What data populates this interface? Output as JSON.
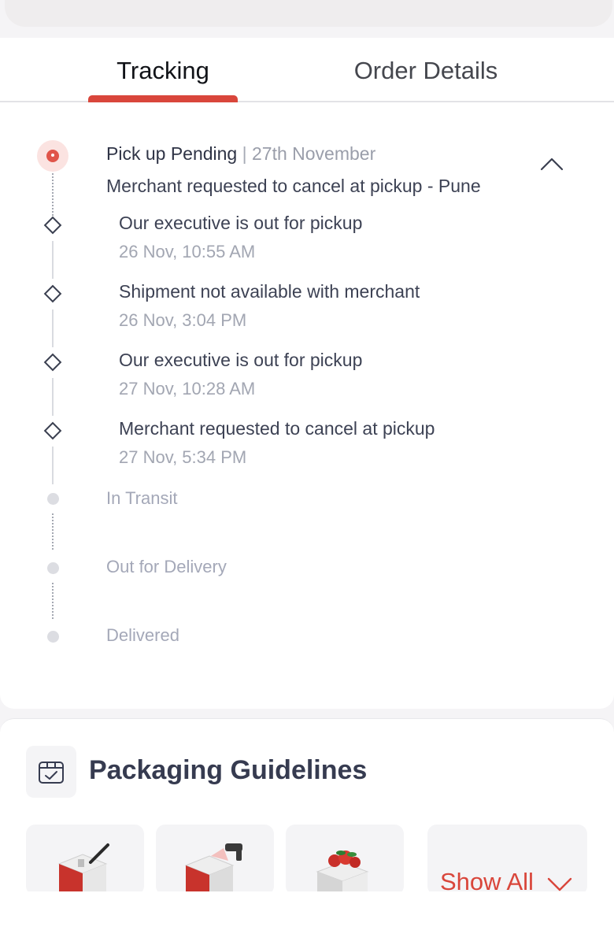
{
  "tabs": [
    {
      "label": "Tracking",
      "active": true
    },
    {
      "label": "Order Details",
      "active": false
    }
  ],
  "colors": {
    "accent": "#d9463b",
    "active_dot": "#e0554a",
    "muted": "#a4a8b8"
  },
  "current_status": {
    "title": "Pick up Pending",
    "separator": "|",
    "date": "27th November",
    "description": "Merchant requested to cancel at pickup - Pune"
  },
  "events": [
    {
      "text": "Our executive is out for pickup",
      "time": "26 Nov, 10:55 AM"
    },
    {
      "text": "Shipment not available with merchant",
      "time": "26 Nov, 3:04 PM"
    },
    {
      "text": "Our executive is out for pickup",
      "time": "27 Nov, 10:28 AM"
    },
    {
      "text": "Merchant requested to cancel at pickup",
      "time": "27 Nov, 5:34 PM"
    }
  ],
  "future_steps": [
    {
      "label": "In Transit"
    },
    {
      "label": "Out for Delivery"
    },
    {
      "label": "Delivered"
    }
  ],
  "packaging": {
    "title": "Packaging Guidelines",
    "show_all_label": "Show All",
    "icon": "box-check-icon",
    "tiles": [
      "box-with-pen-icon",
      "box-with-scanner-icon",
      "box-with-fragile-items-icon"
    ]
  }
}
